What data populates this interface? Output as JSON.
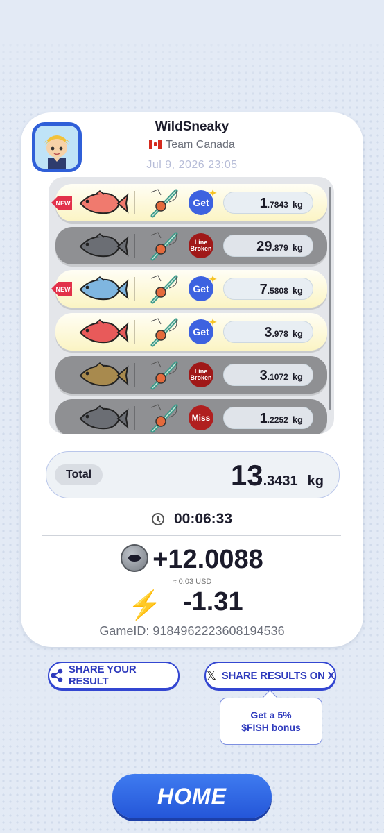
{
  "profile": {
    "username": "WildSneaky",
    "team": "Team Canada",
    "datetime": "Jul 9, 2026 23:05"
  },
  "catches": [
    {
      "new": true,
      "result": "get",
      "status_label": "Get",
      "weight_int": "1",
      "weight_dec": ".7843",
      "unit": "kg",
      "fish_color": "#f07a6e"
    },
    {
      "new": false,
      "result": "broken",
      "status_label": "Line Broken",
      "weight_int": "29",
      "weight_dec": ".879",
      "unit": "kg",
      "fish_color": "#6b6e74"
    },
    {
      "new": true,
      "result": "get",
      "status_label": "Get",
      "weight_int": "7",
      "weight_dec": ".5808",
      "unit": "kg",
      "fish_color": "#7fb6e0"
    },
    {
      "new": false,
      "result": "get",
      "status_label": "Get",
      "weight_int": "3",
      "weight_dec": ".978",
      "unit": "kg",
      "fish_color": "#e85a5a"
    },
    {
      "new": false,
      "result": "broken",
      "status_label": "Line Broken",
      "weight_int": "3",
      "weight_dec": ".1072",
      "unit": "kg",
      "fish_color": "#a88a4e"
    },
    {
      "new": false,
      "result": "miss",
      "status_label": "Miss",
      "weight_int": "1",
      "weight_dec": ".2252",
      "unit": "kg",
      "fish_color": "#6b6e74"
    }
  ],
  "new_badge_label": "NEW",
  "total": {
    "label": "Total",
    "int": "13",
    "dec": ".3431",
    "unit": "kg"
  },
  "timer": "00:06:33",
  "reward": {
    "value": "+12.0088",
    "usd": "≈ 0.03 USD"
  },
  "energy": {
    "value": "-1.31"
  },
  "game_id": "GameID: 9184962223608194536",
  "buttons": {
    "share": "SHARE YOUR RESULT",
    "share_x": "SHARE RESULTS ON X",
    "home": "HOME"
  },
  "bonus_tooltip": {
    "line1": "Get a 5%",
    "line2": "$FISH bonus"
  },
  "colors": {
    "accent": "#3346d1",
    "home_button": "#2f62e3",
    "get_badge": "#3d62e0",
    "fail_badge": "#a01818"
  }
}
